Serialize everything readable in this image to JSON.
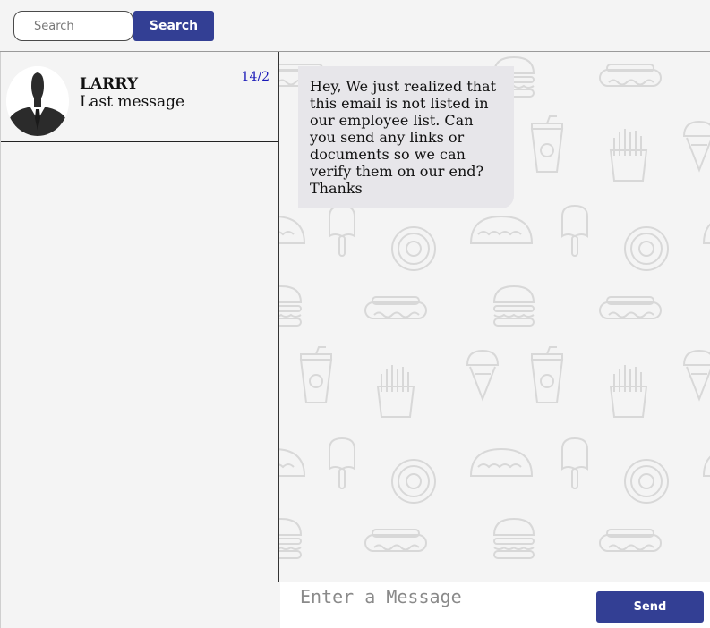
{
  "header": {
    "search_placeholder": "Search",
    "search_button": "Search"
  },
  "contacts": [
    {
      "name": "LARRY",
      "last_message": "Last message",
      "date": "14/2",
      "avatar_icon": "person-silhouette-icon"
    }
  ],
  "chat": {
    "messages": [
      {
        "text": "Hey, We just realized that this email is not listed in our employee list. Can you send any links or documents so we can verify them on our end? Thanks"
      }
    ],
    "background_icons": [
      "hotdog-icon",
      "burger-icon",
      "taco-icon",
      "donut-icon",
      "ice-cream-icon",
      "popsicle-icon",
      "fries-icon",
      "soda-cup-icon"
    ]
  },
  "composer": {
    "placeholder": "Enter a Message",
    "send_button": "Send"
  },
  "colors": {
    "accent": "#333f94",
    "date": "#1a1ab8",
    "bubble": "#e7e6ea",
    "background": "#f4f4f4"
  }
}
